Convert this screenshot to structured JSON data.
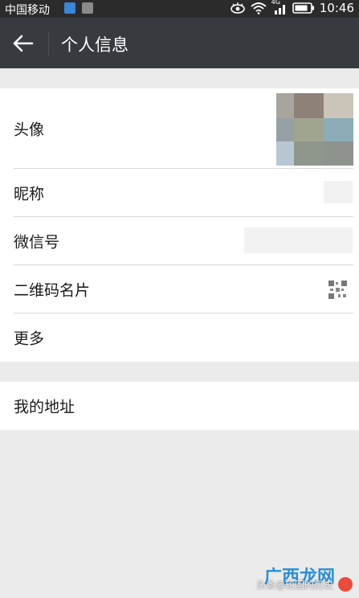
{
  "status_bar": {
    "carrier": "中国移动",
    "network": "4G",
    "time": "10:46"
  },
  "app_bar": {
    "title": "个人信息"
  },
  "profile": {
    "rows": [
      {
        "label": "头像"
      },
      {
        "label": "昵称"
      },
      {
        "label": "微信号"
      },
      {
        "label": "二维码名片"
      },
      {
        "label": "更多"
      }
    ]
  },
  "address": {
    "label": "我的地址"
  },
  "watermark": {
    "logo": "广西龙网",
    "caption": "头条@轮回的历史"
  },
  "avatar_colors": [
    "#a9a49e",
    "#8e8178",
    "#cac5b8",
    "#97a0a5",
    "#a0a58f",
    "#8cacb8",
    "#b8c8d3",
    "#8f968c",
    "#8f938e"
  ],
  "colors": {
    "app_bar": "#373a3f",
    "status_bar": "#2b2b2b",
    "background": "#ebebeb"
  }
}
